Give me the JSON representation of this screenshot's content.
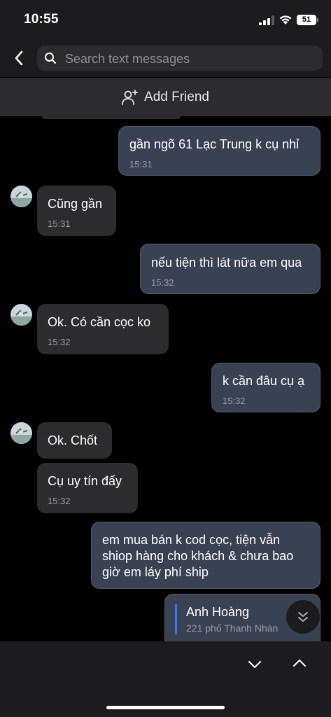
{
  "status_bar": {
    "time": "10:55",
    "battery": "51"
  },
  "header": {
    "search_placeholder": "Search text messages"
  },
  "add_friend": {
    "label": "Add Friend"
  },
  "messages": [
    {
      "direction": "out",
      "text": "gần ngõ 61 Lạc Trung k cụ nhỉ",
      "time": "15:31"
    },
    {
      "direction": "in",
      "text": "Cũng gần",
      "time": "15:31"
    },
    {
      "direction": "out",
      "text": "nếu tiện thì lát nữa em qua",
      "time": "15:32"
    },
    {
      "direction": "in",
      "text": "Ok. Có cần cọc ko",
      "time": "15:32"
    },
    {
      "direction": "out",
      "text": "k cần đâu cụ ạ",
      "time": "15:32"
    },
    {
      "direction": "in",
      "text": "Ok. Chốt"
    },
    {
      "direction": "in",
      "text": "Cụ uy tín đấy",
      "time": "15:32"
    },
    {
      "direction": "out",
      "lines": [
        "em mua bán k cod cọc, tiện vẫn",
        "shiop hàng cho khách & chưa bao",
        "giờ em láy phí ship"
      ]
    },
    {
      "direction": "out",
      "type": "contact",
      "name": "Anh Hoàng",
      "address": "221 phố Thanh Nhàn"
    }
  ],
  "colors": {
    "incoming_bubble": "#2c2c2e",
    "outgoing_bubble": "#394252",
    "contact_accent": "#3478f6"
  }
}
